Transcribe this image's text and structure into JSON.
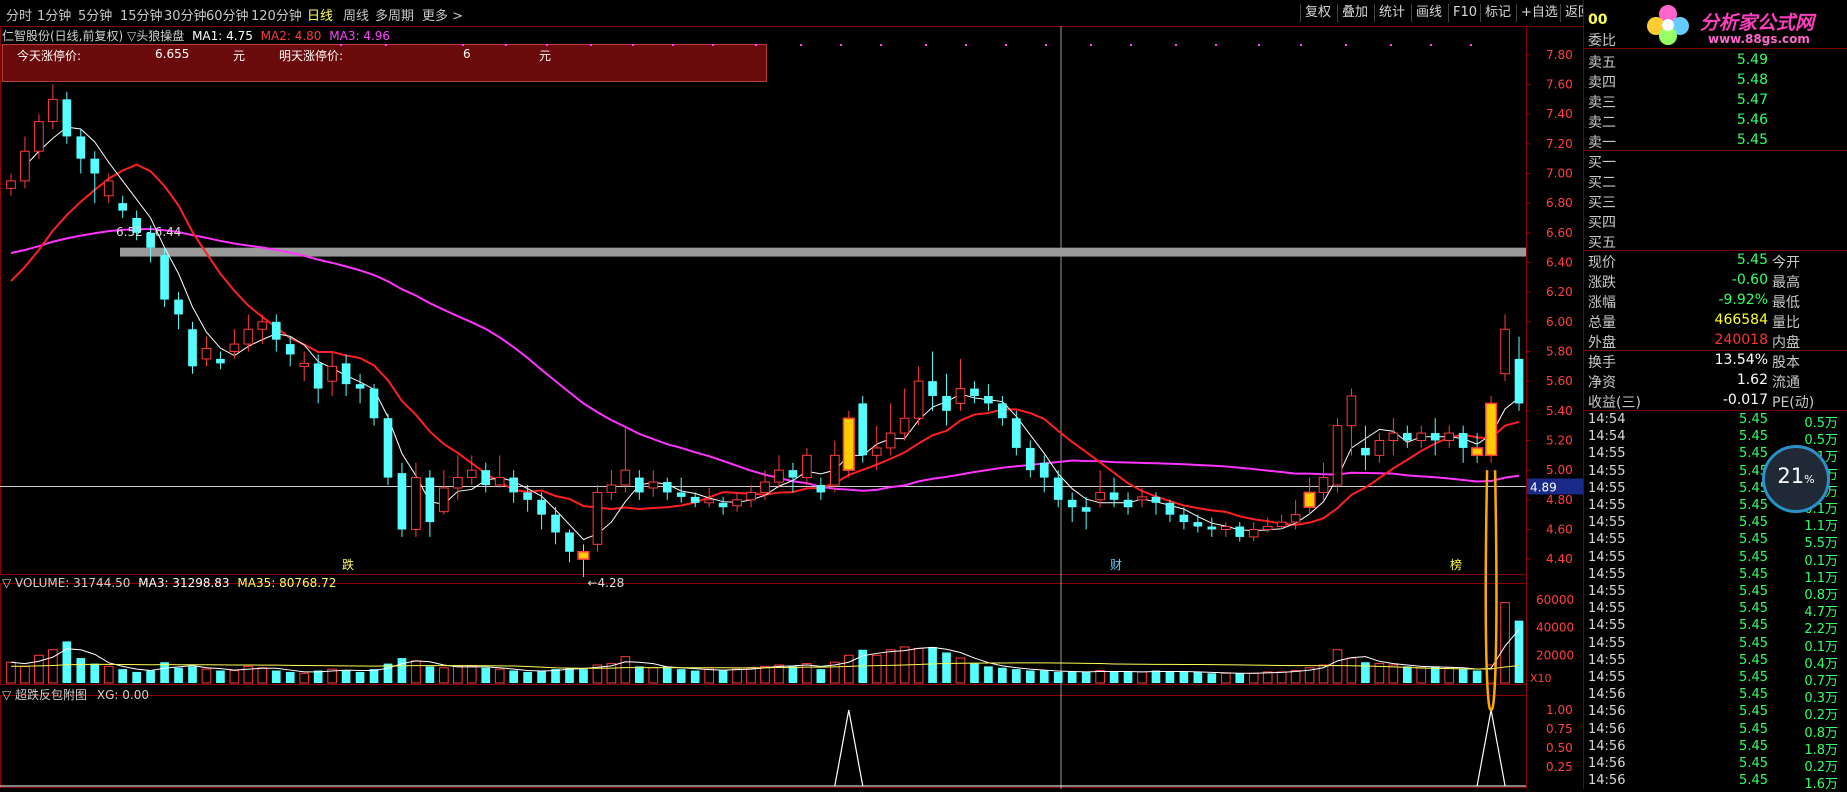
{
  "toolbar": {
    "periods": [
      "分时",
      "1分钟",
      "5分钟",
      "15分钟",
      "30分钟",
      "60分钟",
      "120分钟",
      "日线",
      "周线",
      "多周期",
      "更多 >"
    ],
    "active": "日线",
    "buttons": [
      "复权",
      "叠加",
      "统计",
      "画线",
      "F10",
      "标记",
      "+自选",
      "返回"
    ]
  },
  "logo": {
    "name": "分析家公式网",
    "url": "www.88gs.com",
    "code_digits": "00"
  },
  "main_header": {
    "title": "仁智股份(日线,前复权) ▽头狼操盘",
    "ma1": "MA1: 4.75",
    "ma2": "MA2: 4.80",
    "ma3": "MA3: 4.96"
  },
  "info_box": {
    "today_label": "今天涨停价:",
    "today_value": "6.655",
    "today_unit": "元",
    "tomorrow_label": "明天涨停价:",
    "tomorrow_value": "6",
    "tomorrow_unit": "元"
  },
  "price_axis": [
    "7.80",
    "7.60",
    "7.40",
    "7.20",
    "7.00",
    "6.80",
    "6.60",
    "6.40",
    "6.20",
    "6.00",
    "5.80",
    "5.60",
    "5.40",
    "5.20",
    "5.00",
    "4.80",
    "4.60",
    "4.40"
  ],
  "annotations": {
    "range_label": "6.52 - 6.44",
    "low_label": "←4.28",
    "crosshair_price": "4.89",
    "marker_die": "跌",
    "marker_cai": "财",
    "marker_bang": "榜"
  },
  "volume_header": {
    "title": "▽ VOLUME: 31744.50",
    "ma3": "MA3: 31298.83",
    "ma35": "MA35: 80768.72"
  },
  "volume_axis": [
    "60000",
    "40000",
    "20000"
  ],
  "volume_unit": "X10",
  "sub_header": {
    "title": "▽ 超跌反包附图",
    "xg": "XG: 0.00"
  },
  "sub_axis": [
    "1.00",
    "0.75",
    "0.50",
    "0.25"
  ],
  "colors": {
    "up": "#ff3b3b",
    "down": "#55ffff",
    "ma_white": "#ffffff",
    "ma_red": "#ff2020",
    "ma_magenta": "#ff33ff",
    "signal": "#ffcc00",
    "grid_border": "#8b0000"
  },
  "chart_data": {
    "type": "candlestick",
    "ylim": [
      4.3,
      7.9
    ],
    "candles": [
      [
        6.9,
        6.95,
        6.85,
        7.0
      ],
      [
        6.95,
        7.15,
        6.9,
        7.25
      ],
      [
        7.15,
        7.35,
        7.1,
        7.4
      ],
      [
        7.35,
        7.5,
        7.3,
        7.6
      ],
      [
        7.5,
        7.25,
        7.2,
        7.55
      ],
      [
        7.25,
        7.1,
        7.0,
        7.3
      ],
      [
        7.1,
        7.0,
        6.8,
        7.15
      ],
      [
        6.85,
        6.95,
        6.8,
        7.0
      ],
      [
        6.8,
        6.75,
        6.7,
        6.85
      ],
      [
        6.7,
        6.6,
        6.55,
        6.75
      ],
      [
        6.6,
        6.5,
        6.4,
        6.65
      ],
      [
        6.45,
        6.15,
        6.1,
        6.5
      ],
      [
        6.15,
        6.05,
        5.95,
        6.2
      ],
      [
        5.95,
        5.7,
        5.65,
        6.0
      ],
      [
        5.75,
        5.82,
        5.7,
        5.9
      ],
      [
        5.75,
        5.72,
        5.68,
        5.8
      ],
      [
        5.8,
        5.85,
        5.75,
        5.95
      ],
      [
        5.85,
        5.95,
        5.8,
        6.05
      ],
      [
        5.95,
        6.0,
        5.85,
        6.05
      ],
      [
        6.0,
        5.88,
        5.8,
        6.05
      ],
      [
        5.85,
        5.78,
        5.7,
        5.9
      ],
      [
        5.7,
        5.72,
        5.6,
        5.8
      ],
      [
        5.72,
        5.55,
        5.45,
        5.78
      ],
      [
        5.6,
        5.7,
        5.5,
        5.8
      ],
      [
        5.72,
        5.58,
        5.5,
        5.78
      ],
      [
        5.58,
        5.55,
        5.45,
        5.65
      ],
      [
        5.55,
        5.35,
        5.3,
        5.58
      ],
      [
        5.35,
        4.95,
        4.9,
        5.38
      ],
      [
        4.98,
        4.6,
        4.55,
        5.05
      ],
      [
        4.6,
        4.95,
        4.55,
        5.05
      ],
      [
        4.95,
        4.65,
        4.55,
        5.0
      ],
      [
        4.72,
        4.88,
        4.7,
        5.0
      ],
      [
        4.88,
        4.95,
        4.8,
        5.1
      ],
      [
        4.95,
        5.0,
        4.9,
        5.1
      ],
      [
        5.0,
        4.9,
        4.85,
        5.05
      ],
      [
        4.9,
        4.95,
        4.88,
        5.1
      ],
      [
        4.95,
        4.85,
        4.78,
        5.0
      ],
      [
        4.85,
        4.8,
        4.72,
        4.9
      ],
      [
        4.8,
        4.7,
        4.6,
        4.85
      ],
      [
        4.7,
        4.58,
        4.5,
        4.75
      ],
      [
        4.58,
        4.45,
        4.38,
        4.6
      ],
      [
        4.45,
        4.4,
        4.28,
        4.5
      ],
      [
        4.5,
        4.85,
        4.45,
        4.9
      ],
      [
        4.85,
        4.9,
        4.8,
        5.0
      ],
      [
        4.9,
        5.0,
        4.85,
        5.3
      ],
      [
        4.95,
        4.85,
        4.8,
        5.0
      ],
      [
        4.88,
        4.92,
        4.82,
        5.0
      ],
      [
        4.92,
        4.85,
        4.8,
        4.95
      ],
      [
        4.85,
        4.82,
        4.78,
        4.95
      ],
      [
        4.82,
        4.78,
        4.75,
        4.85
      ],
      [
        4.78,
        4.8,
        4.75,
        4.88
      ],
      [
        4.78,
        4.75,
        4.7,
        4.82
      ],
      [
        4.76,
        4.8,
        4.72,
        4.85
      ],
      [
        4.8,
        4.85,
        4.75,
        4.9
      ],
      [
        4.85,
        4.92,
        4.8,
        5.0
      ],
      [
        4.92,
        5.0,
        4.88,
        5.1
      ],
      [
        5.0,
        4.95,
        4.85,
        5.05
      ],
      [
        4.95,
        5.1,
        4.9,
        5.15
      ],
      [
        4.9,
        4.85,
        4.8,
        4.95
      ],
      [
        4.9,
        5.1,
        4.85,
        5.2
      ],
      [
        5.0,
        5.35,
        4.95,
        5.4
      ],
      [
        5.45,
        5.1,
        5.05,
        5.5
      ],
      [
        5.1,
        5.15,
        5.0,
        5.3
      ],
      [
        5.15,
        5.25,
        5.1,
        5.45
      ],
      [
        5.25,
        5.35,
        5.2,
        5.55
      ],
      [
        5.35,
        5.6,
        5.3,
        5.7
      ],
      [
        5.6,
        5.5,
        5.4,
        5.8
      ],
      [
        5.5,
        5.4,
        5.3,
        5.65
      ],
      [
        5.45,
        5.55,
        5.4,
        5.75
      ],
      [
        5.55,
        5.5,
        5.45,
        5.6
      ],
      [
        5.5,
        5.45,
        5.4,
        5.58
      ],
      [
        5.45,
        5.35,
        5.3,
        5.5
      ],
      [
        5.35,
        5.15,
        5.1,
        5.4
      ],
      [
        5.15,
        5.0,
        4.95,
        5.2
      ],
      [
        5.05,
        4.95,
        4.85,
        5.1
      ],
      [
        4.95,
        4.8,
        4.75,
        5.0
      ],
      [
        4.8,
        4.75,
        4.65,
        4.85
      ],
      [
        4.75,
        4.72,
        4.6,
        4.82
      ],
      [
        4.8,
        4.85,
        4.75,
        5.0
      ],
      [
        4.85,
        4.8,
        4.75,
        4.95
      ],
      [
        4.8,
        4.75,
        4.7,
        4.85
      ],
      [
        4.8,
        4.82,
        4.75,
        4.88
      ],
      [
        4.82,
        4.78,
        4.7,
        4.85
      ],
      [
        4.78,
        4.7,
        4.65,
        4.8
      ],
      [
        4.7,
        4.65,
        4.6,
        4.75
      ],
      [
        4.65,
        4.62,
        4.58,
        4.7
      ],
      [
        4.62,
        4.6,
        4.55,
        4.68
      ],
      [
        4.6,
        4.62,
        4.55,
        4.65
      ],
      [
        4.62,
        4.55,
        4.52,
        4.65
      ],
      [
        4.55,
        4.6,
        4.52,
        4.65
      ],
      [
        4.6,
        4.62,
        4.58,
        4.68
      ],
      [
        4.62,
        4.65,
        4.6,
        4.7
      ],
      [
        4.65,
        4.7,
        4.6,
        4.8
      ],
      [
        4.75,
        4.85,
        4.7,
        4.95
      ],
      [
        4.85,
        4.95,
        4.8,
        5.05
      ],
      [
        4.9,
        5.3,
        4.85,
        5.35
      ],
      [
        5.3,
        5.5,
        5.1,
        5.55
      ],
      [
        5.15,
        5.1,
        5.0,
        5.3
      ],
      [
        5.1,
        5.2,
        5.05,
        5.25
      ],
      [
        5.2,
        5.25,
        5.1,
        5.35
      ],
      [
        5.25,
        5.2,
        5.15,
        5.3
      ],
      [
        5.2,
        5.25,
        5.15,
        5.3
      ],
      [
        5.25,
        5.2,
        5.1,
        5.35
      ],
      [
        5.2,
        5.25,
        5.15,
        5.3
      ],
      [
        5.25,
        5.15,
        5.05,
        5.3
      ],
      [
        5.15,
        5.1,
        5.05,
        5.25
      ],
      [
        5.1,
        5.45,
        5.05,
        5.5
      ],
      [
        5.65,
        5.95,
        5.6,
        6.05
      ],
      [
        5.75,
        5.45,
        5.4,
        5.9
      ]
    ],
    "signal_indices": [
      41,
      60,
      93,
      105,
      106
    ],
    "spike_indices": [
      60,
      106
    ],
    "volume_values": [
      15000,
      12000,
      20000,
      24000,
      30000,
      18000,
      14000,
      12000,
      10000,
      8000,
      9000,
      15000,
      11000,
      12000,
      10000,
      9000,
      9000,
      12000,
      11000,
      9000,
      8000,
      7000,
      9000,
      10000,
      9000,
      8000,
      10000,
      14000,
      18000,
      16000,
      12000,
      11000,
      12000,
      12000,
      11000,
      10000,
      9000,
      8000,
      9000,
      10000,
      11000,
      10000,
      13000,
      14000,
      19000,
      12000,
      11000,
      12000,
      10000,
      9000,
      10000,
      9000,
      10000,
      11000,
      12000,
      13000,
      12000,
      14000,
      10000,
      15000,
      20000,
      24000,
      20000,
      24000,
      26000,
      25000,
      26000,
      22000,
      18000,
      14000,
      12000,
      11000,
      10000,
      9000,
      9000,
      8000,
      8000,
      8000,
      9000,
      8000,
      8000,
      8000,
      9000,
      8000,
      8000,
      8000,
      7000,
      7000,
      7000,
      7000,
      8000,
      8000,
      9000,
      11000,
      13000,
      24000,
      18000,
      15000,
      14000,
      13000,
      12000,
      11000,
      12000,
      11000,
      10000,
      9000,
      13000,
      58000,
      45000
    ]
  },
  "right_panel": {
    "weibi_label": "委比",
    "asks": [
      {
        "label": "卖五",
        "price": "5.49"
      },
      {
        "label": "卖四",
        "price": "5.48"
      },
      {
        "label": "卖三",
        "price": "5.47"
      },
      {
        "label": "卖二",
        "price": "5.46"
      },
      {
        "label": "卖一",
        "price": "5.45"
      }
    ],
    "bids": [
      "买一",
      "买二",
      "买三",
      "买四",
      "买五"
    ],
    "stats": [
      {
        "label": "现价",
        "value": "5.45",
        "extra": "今开",
        "color": "#33ff66"
      },
      {
        "label": "涨跌",
        "value": "-0.60",
        "extra": "最高",
        "color": "#33ff66"
      },
      {
        "label": "涨幅",
        "value": "-9.92%",
        "extra": "最低",
        "color": "#33ff66"
      },
      {
        "label": "总量",
        "value": "466584",
        "extra": "量比",
        "color": "#ffff33"
      },
      {
        "label": "外盘",
        "value": "240018",
        "extra": "内盘",
        "color": "#ff3333"
      }
    ],
    "stats2": [
      {
        "label": "换手",
        "value": "13.54%",
        "extra": "股本"
      },
      {
        "label": "净资",
        "value": "1.62",
        "extra": "流通"
      },
      {
        "label": "收益(三)",
        "value": "-0.017",
        "extra": "PE(动)"
      }
    ],
    "ticks": [
      {
        "t": "14:54",
        "p": "5.45",
        "v": "0.5万"
      },
      {
        "t": "14:54",
        "p": "5.45",
        "v": "0.5万"
      },
      {
        "t": "14:55",
        "p": "5.45",
        "v": "0.1万"
      },
      {
        "t": "14:55",
        "p": "5.45",
        "v": "0.4万"
      },
      {
        "t": "14:55",
        "p": "5.45",
        "v": "0.1万"
      },
      {
        "t": "14:55",
        "p": "5.45",
        "v": "0.1万"
      },
      {
        "t": "14:55",
        "p": "5.45",
        "v": "1.1万"
      },
      {
        "t": "14:55",
        "p": "5.45",
        "v": "5.5万"
      },
      {
        "t": "14:55",
        "p": "5.45",
        "v": "0.1万"
      },
      {
        "t": "14:55",
        "p": "5.45",
        "v": "1.1万"
      },
      {
        "t": "14:55",
        "p": "5.45",
        "v": "0.8万"
      },
      {
        "t": "14:55",
        "p": "5.45",
        "v": "4.7万"
      },
      {
        "t": "14:55",
        "p": "5.45",
        "v": "2.2万"
      },
      {
        "t": "14:55",
        "p": "5.45",
        "v": "0.1万"
      },
      {
        "t": "14:55",
        "p": "5.45",
        "v": "0.4万"
      },
      {
        "t": "14:55",
        "p": "5.45",
        "v": "0.7万"
      },
      {
        "t": "14:56",
        "p": "5.45",
        "v": "0.3万"
      },
      {
        "t": "14:56",
        "p": "5.45",
        "v": "0.2万"
      },
      {
        "t": "14:56",
        "p": "5.45",
        "v": "0.8万"
      },
      {
        "t": "14:56",
        "p": "5.45",
        "v": "1.8万"
      },
      {
        "t": "14:56",
        "p": "5.45",
        "v": "0.2万"
      },
      {
        "t": "14:56",
        "p": "5.45",
        "v": "1.6万"
      }
    ],
    "gauge_value": "21",
    "gauge_unit": "%"
  }
}
